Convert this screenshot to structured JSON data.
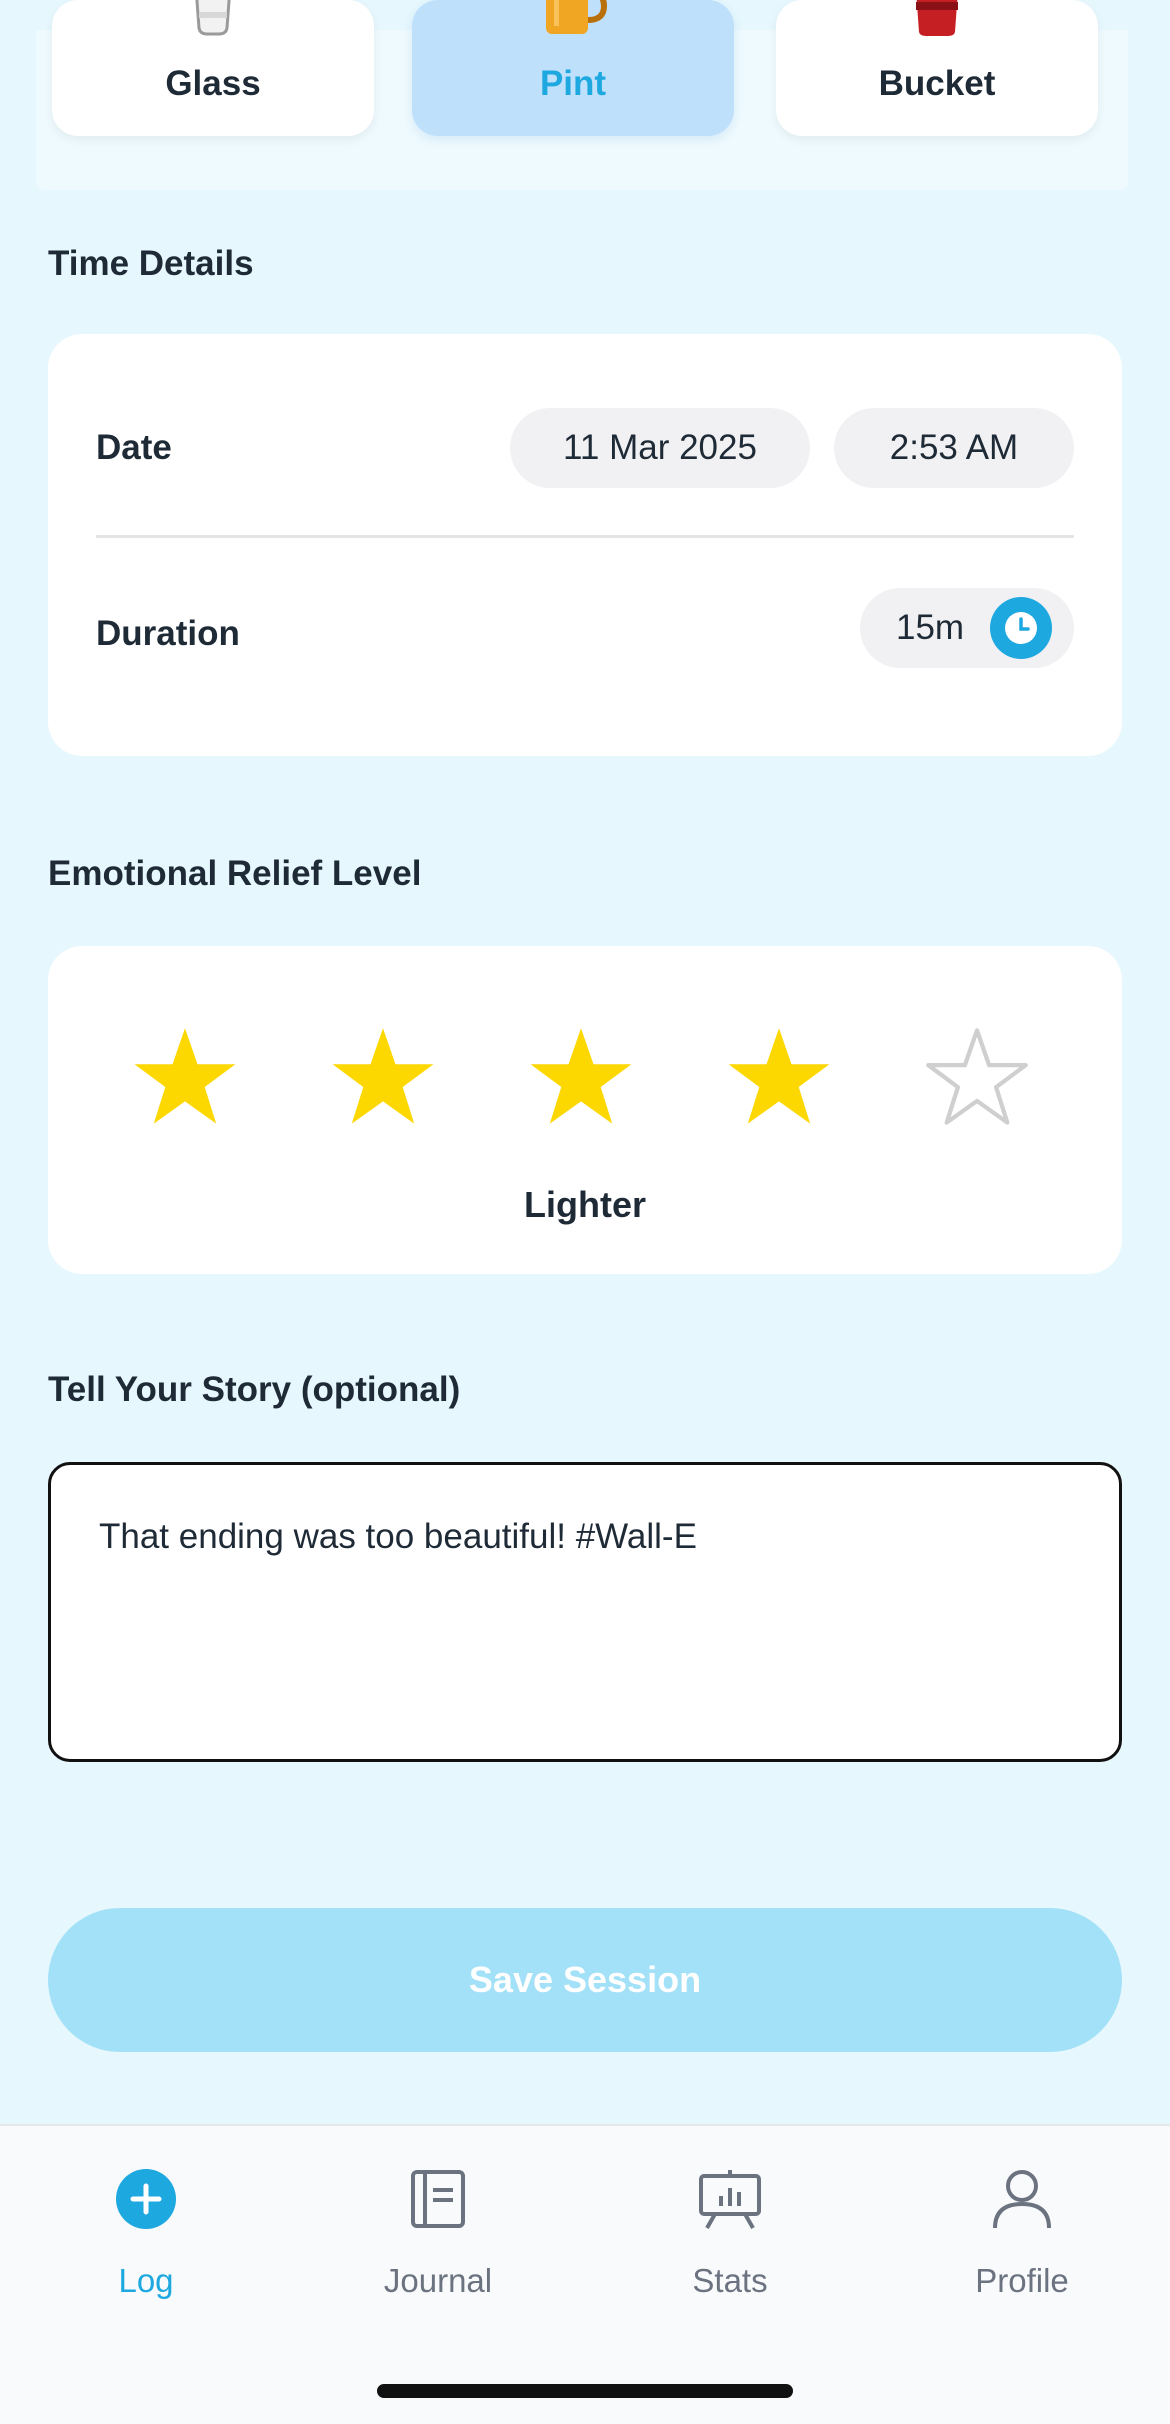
{
  "containers": [
    {
      "label": "Glass",
      "icon": "glass-icon",
      "selected": false
    },
    {
      "label": "Pint",
      "icon": "beer-mug-icon",
      "selected": true
    },
    {
      "label": "Bucket",
      "icon": "bucket-icon",
      "selected": false
    }
  ],
  "time_details": {
    "title": "Time Details",
    "date_label": "Date",
    "date_value": "11 Mar 2025",
    "time_value": "2:53 AM",
    "duration_label": "Duration",
    "duration_value": "15m"
  },
  "relief": {
    "title": "Emotional Relief Level",
    "rating": 4,
    "max_rating": 5,
    "rating_label": "Lighter"
  },
  "story": {
    "title": "Tell Your Story (optional)",
    "text": "That ending was too beautiful! #Wall-E"
  },
  "save_button": {
    "label": "Save Session"
  },
  "tabs": [
    {
      "label": "Log",
      "icon": "plus-circle-icon",
      "active": true
    },
    {
      "label": "Journal",
      "icon": "journal-icon",
      "active": false
    },
    {
      "label": "Stats",
      "icon": "stats-board-icon",
      "active": false
    },
    {
      "label": "Profile",
      "icon": "person-icon",
      "active": false
    }
  ],
  "colors": {
    "accent": "#1da8e0",
    "background": "#e6f7fd",
    "star_filled": "#fdd700",
    "star_empty": "#cfcfcf",
    "selected_card": "#bfe0fb",
    "save_button": "#a2e1f7"
  }
}
